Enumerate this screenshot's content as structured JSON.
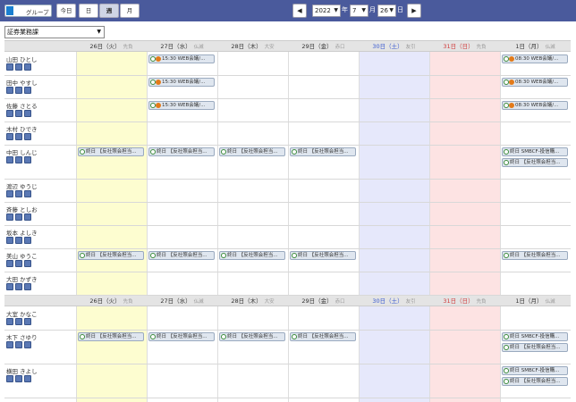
{
  "toolbar": {
    "group_label": "グループ",
    "today_label": "今日",
    "day_label": "日",
    "week_label": "週",
    "month_label": "月",
    "year": "2022",
    "year_unit": "年",
    "month": "7",
    "month_unit": "月",
    "day": "26",
    "day_unit": "日",
    "prev_icon": "◀",
    "next_icon": "▶"
  },
  "department": "証券業務課",
  "columns": [
    {
      "date": "26日（火）",
      "rokuyo": "先負",
      "color": "#fdfdd0"
    },
    {
      "date": "27日（水）",
      "rokuyo": "仏滅",
      "color": "#fff"
    },
    {
      "date": "28日（木）",
      "rokuyo": "大安",
      "color": "#fff"
    },
    {
      "date": "29日（金）",
      "rokuyo": "赤口",
      "color": "#fff"
    },
    {
      "date": "30日（土）",
      "rokuyo": "友引",
      "color": "#e6e8fb",
      "text": "#3a5ad0"
    },
    {
      "date": "31日（日）",
      "rokuyo": "先負",
      "color": "#fde3e3",
      "text": "#d03a3a"
    },
    {
      "date": "1日（月）",
      "rokuyo": "仏滅",
      "color": "#fff"
    }
  ],
  "members": [
    {
      "name": "山田 ひとし",
      "events": [
        null,
        "15:30 WEB会議/...",
        null,
        null,
        null,
        null,
        "08:30 WEB会議/..."
      ]
    },
    {
      "name": "田中 やすし",
      "events": [
        null,
        "15:30 WEB会議/...",
        null,
        null,
        null,
        null,
        "08:30 WEB会議/..."
      ]
    },
    {
      "name": "佐藤 さとる",
      "events": [
        null,
        "15:30 WEB会議/...",
        null,
        null,
        null,
        null,
        "08:30 WEB会議/..."
      ]
    },
    {
      "name": "木村 ひでき",
      "events": [
        null,
        null,
        null,
        null,
        null,
        null,
        null
      ]
    },
    {
      "name": "中田 しんじ",
      "events": [
        "終日 【反社照会担当...",
        "終日 【反社照会担当...",
        "終日 【反社照会担当...",
        "終日 【反社照会担当...",
        null,
        null,
        "終日 SMBCF-投信購...",
        "終日 【反社照会担当..."
      ]
    },
    {
      "name": "渡辺 ゆうじ",
      "events": [
        null,
        null,
        null,
        null,
        null,
        null,
        null
      ]
    },
    {
      "name": "斉藤 としお",
      "events": [
        null,
        null,
        null,
        null,
        null,
        null,
        null
      ]
    },
    {
      "name": "坂本 よしき",
      "events": [
        null,
        null,
        null,
        null,
        null,
        null,
        null
      ]
    },
    {
      "name": "美山 ゆうこ",
      "events": [
        "終日 【反社照会担当...",
        "終日 【反社照会担当...",
        "終日 【反社照会担当...",
        "終日 【反社照会担当...",
        null,
        null,
        "終日 【反社照会担当..."
      ]
    },
    {
      "name": "大田 かずき",
      "events": [
        null,
        null,
        null,
        null,
        null,
        null,
        null
      ]
    },
    {
      "name": "大室 かなこ",
      "events": [
        null,
        null,
        null,
        null,
        null,
        null,
        null
      ]
    },
    {
      "name": "木下 さゆり",
      "events": [
        "終日 【反社照会担当...",
        "終日 【反社照会担当...",
        "終日 【反社照会担当...",
        "終日 【反社照会担当...",
        null,
        null,
        "終日 SMBCF-投信購...",
        "終日 【反社照会担当..."
      ]
    },
    {
      "name": "横田 きよし",
      "events": [
        null,
        null,
        null,
        null,
        null,
        null,
        "終日 SMBCF-投信購...",
        "終日 【反社照会担当..."
      ]
    }
  ],
  "icon_names": [
    "calendar-icon",
    "calendar-icon",
    "calendar-icon"
  ]
}
